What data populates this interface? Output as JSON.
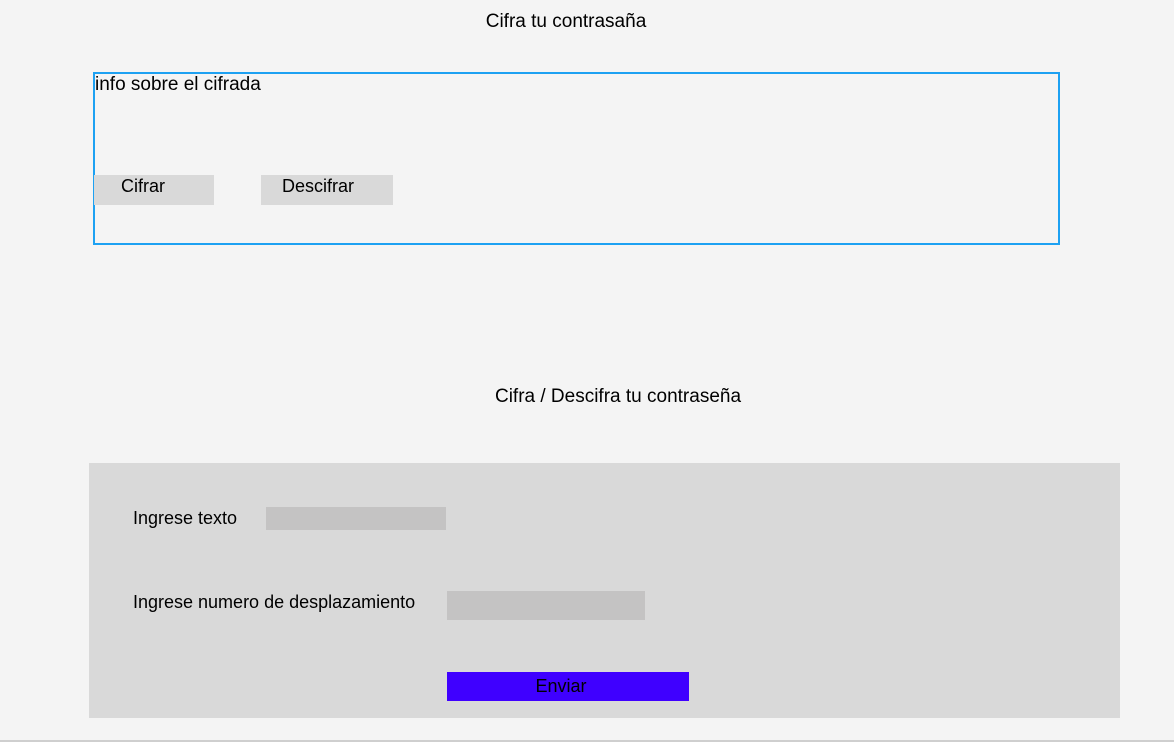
{
  "header": {
    "title": "Cifra tu contrasaña"
  },
  "info_panel": {
    "text": "info sobre el cifrada",
    "cifrar_label": "Cifrar",
    "descifrar_label": "Descifrar"
  },
  "form": {
    "title": "Cifra / Descifra tu contraseña",
    "text_label": "Ingrese texto",
    "text_value": "",
    "shift_label": "Ingrese numero de desplazamiento",
    "shift_value": "",
    "submit_label": "Enviar"
  },
  "colors": {
    "background": "#f4f4f4",
    "panel_border": "#1da1f2",
    "button_gray": "#d9d9d9",
    "input_gray": "#c4c3c3",
    "submit_accent": "#3f00ff"
  }
}
